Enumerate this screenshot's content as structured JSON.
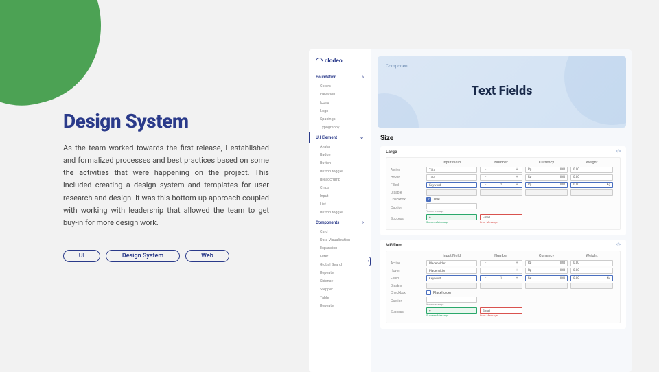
{
  "left": {
    "title": "Design System",
    "body": "As the team worked towards the first release, I established and formalized processes and best practices based on some the activities that were happening on the project. This included creating a design system and templates for user research and design. It was this bottom-up approach coupled with working with leadership that allowed the team to get buy-in for more design work.",
    "pills": [
      "UI",
      "Design System",
      "Web"
    ]
  },
  "app": {
    "brand": "clodeo",
    "sections": {
      "foundation": {
        "label": "Foundation",
        "items": [
          "Colors",
          "Elevation",
          "Icons",
          "Logo",
          "Spacings",
          "Typography"
        ]
      },
      "ui_element": {
        "label": "U.I Element",
        "items": [
          "Avatar",
          "Badge",
          "Button",
          "Button toggle",
          "Breadcrump",
          "Chips",
          "Input",
          "List",
          "Button toggle"
        ]
      },
      "components": {
        "label": "Components",
        "items": [
          "Card",
          "Data Visualization",
          "Expansion",
          "Filter",
          "Global Search",
          "Repeater",
          "Sidenav",
          "Stepper",
          "Table",
          "Repeater"
        ]
      }
    },
    "hero": {
      "eyebrow": "Component",
      "title": "Text Fields"
    },
    "content": {
      "title": "Size",
      "sizes": [
        {
          "label": "Large"
        },
        {
          "label": "MEdium"
        }
      ],
      "columns": [
        "",
        "Input Field",
        "Number",
        "Currency",
        "Weight"
      ],
      "states": [
        "Active",
        "Hover",
        "Filled",
        "Disable",
        "Checkbox",
        "Caption",
        "Success"
      ],
      "placeholders": {
        "title": "Title",
        "keyword": "Keyword",
        "rp": "Rp",
        "currency": "IDR",
        "zero": "0.00",
        "kg": "Kg",
        "email": "Email",
        "placeholder": "Placeholder",
        "your_msg": "Your message",
        "success_msg": "Success Message",
        "error_msg": "Error Message",
        "one": "1"
      }
    },
    "code_icon": "</>"
  }
}
